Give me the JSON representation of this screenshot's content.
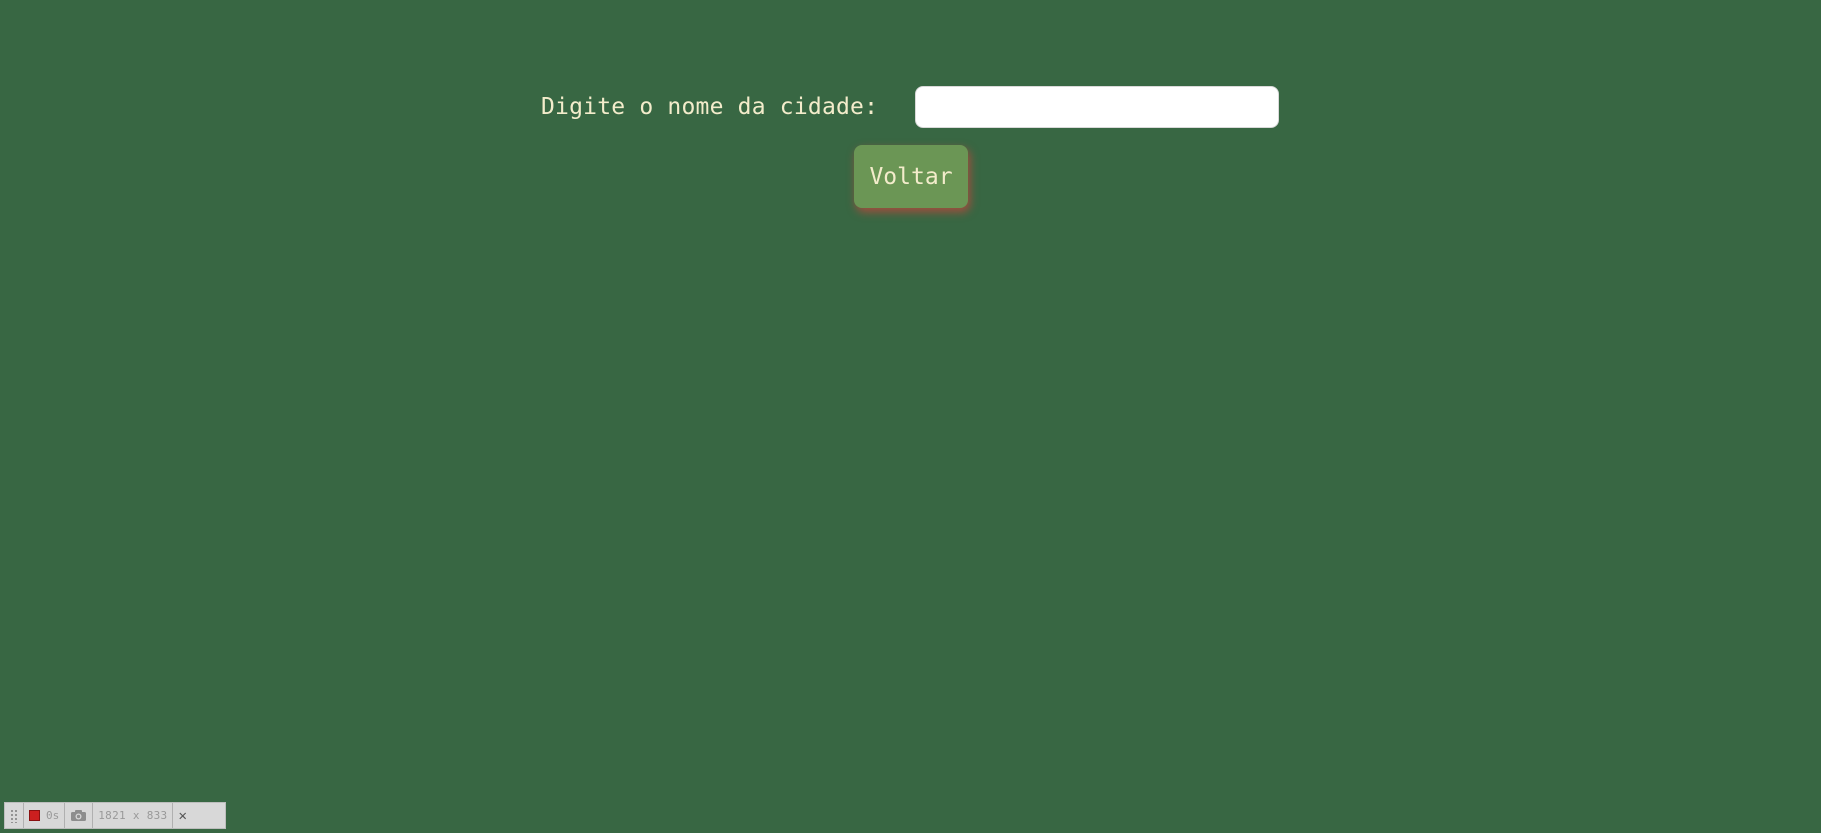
{
  "form": {
    "label": "Digite o nome da cidade:",
    "input_value": "",
    "input_placeholder": "",
    "back_label": "Voltar"
  },
  "toolbar": {
    "timer": "0s",
    "size": "1821 x 833",
    "close": "✕"
  },
  "colors": {
    "background": "#386743",
    "button": "#6b9655",
    "text": "#f3eccb",
    "button_shadow": "#c8463c"
  },
  "icons": [
    "grip-icon",
    "record-icon",
    "camera-icon",
    "close-icon"
  ]
}
